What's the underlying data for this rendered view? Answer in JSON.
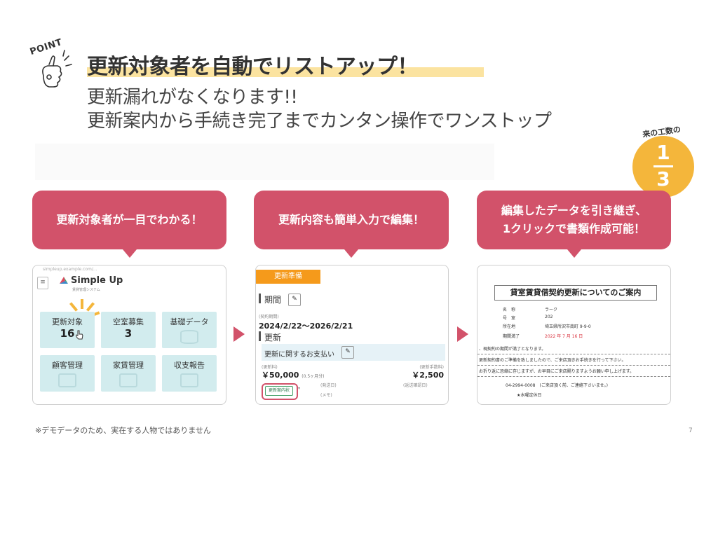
{
  "header": {
    "point_label": "POINT",
    "title": "更新対象者を自動でリストアップ！",
    "subtitle1": "更新漏れがなくなります!!",
    "subtitle2": "更新案内から手続き完了までカンタン操作でワンストップ"
  },
  "ratio": {
    "caption": "来の工数の",
    "numerator": "1",
    "denominator": "3"
  },
  "steps": [
    {
      "bubble": "更新対象者が一目でわかる！"
    },
    {
      "bubble": "更新内容も簡単入力で編集！"
    },
    {
      "bubble": "編集したデータを引き継ぎ、\n1クリックで書類作成可能！"
    }
  ],
  "panel1": {
    "url": "simpleup.example.com/...",
    "menu_icon": "≡",
    "brand": "Simple Up",
    "brand_sub": "賃貸管理システム",
    "tiles": [
      {
        "label": "更新対象",
        "value": "16"
      },
      {
        "label": "空室募集",
        "value": "3"
      },
      {
        "label": "基礎データ",
        "value": ""
      },
      {
        "label": "顧客管理",
        "value": ""
      },
      {
        "label": "家賃管理",
        "value": ""
      },
      {
        "label": "収支報告",
        "value": ""
      }
    ]
  },
  "panel2": {
    "tab": "更新準備",
    "period_heading": "期間",
    "edit_icon": "✎",
    "period_small": "(契約期間)",
    "period": "2024/2/22～2026/2/21",
    "renew_heading": "更新",
    "payment_row": "更新に関するお支払い",
    "fee_small": "(更新料)",
    "fee": "￥50,000",
    "fee_note": "(0.5ヶ月分)",
    "handling_small": "(更新手数料)",
    "handling": "￥2,500",
    "button": "更新案内状",
    "sent_small": "(発送日)",
    "memo_small": "(メモ)",
    "confirm_small": "(返送確認日)"
  },
  "panel3": {
    "doc_title": "貸室賃貸借契約更新についてのご案内",
    "rows": [
      {
        "k": "名　称",
        "v": "ラーク"
      },
      {
        "k": "号　室",
        "v": "202"
      },
      {
        "k": "所在地",
        "v": "埼玉県所沢市南町 9-9-0"
      },
      {
        "k": "期間満了",
        "v": "2022 年 7 月 16 日"
      }
    ],
    "body1": "、現契約の期間が満了となります。",
    "body2": "更新契約書のご準備を致しましたので、ご来店頂きお手続きを行って下さい。",
    "body3": "お折り返に恐縮に存じますが、お早目にご来店賜りますようお願い申し上げます。",
    "tel": "04-2994-0008　(ご来店頂く前、ご連絡下さいませ。)",
    "holiday": "★水曜定休日"
  },
  "footnote": "※デモデータのため、実在する人物ではありません",
  "page_number": "7"
}
